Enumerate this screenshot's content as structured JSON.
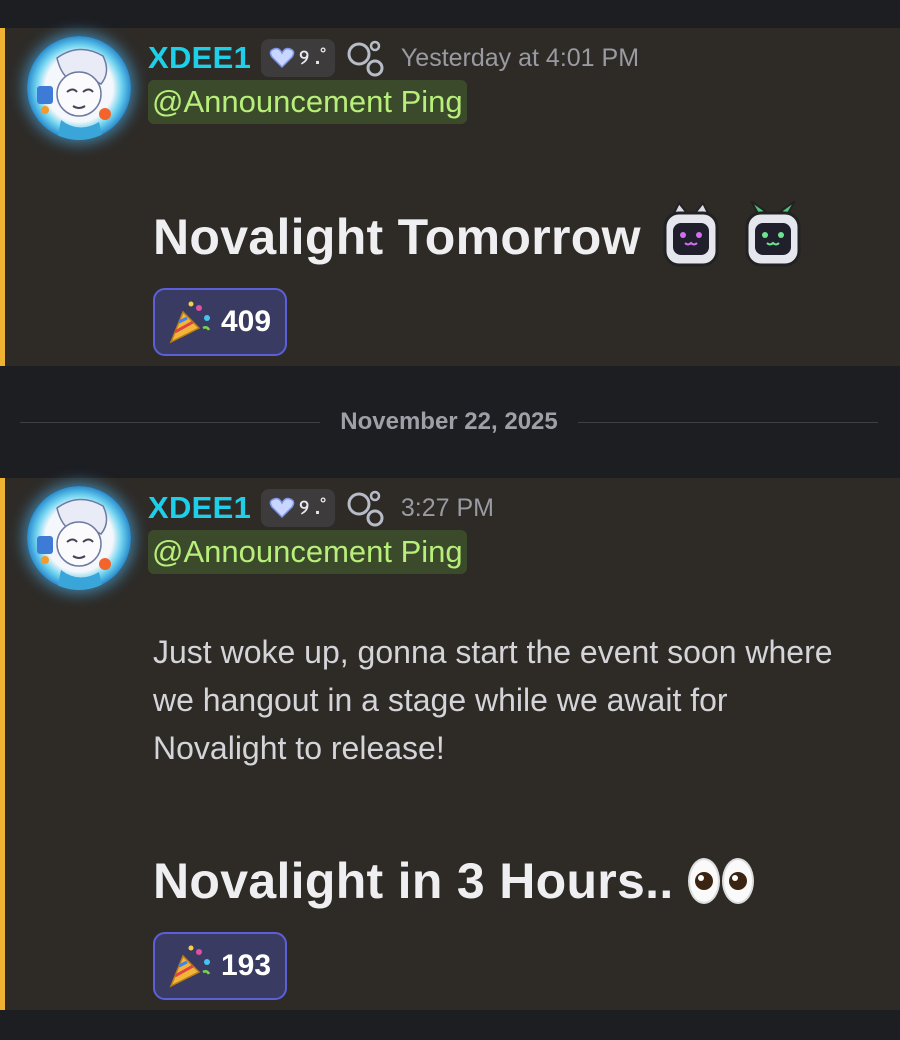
{
  "colors": {
    "username": "#1ecfea",
    "mention_text": "#b8ef7a",
    "mention_bg": "#3a4a2a",
    "highlight_border": "#f0b232",
    "reaction_border": "#5b60d8",
    "message_bg": "#2e2b27",
    "page_bg": "#1d1e22"
  },
  "messages": [
    {
      "username": "XDEE1",
      "tag": "୨ .˚",
      "timestamp": "Yesterday at 4:01 PM",
      "mention": "@Announcement Ping",
      "body": "",
      "headline": "Novalight Tomorrow",
      "headline_emojis": [
        "cat-robot-emoji",
        "bunny-robot-emoji"
      ],
      "reaction": {
        "emoji": "party-popper-icon",
        "count": "409"
      }
    },
    {
      "username": "XDEE1",
      "tag": "୨ .˚",
      "timestamp": "3:27 PM",
      "mention": "@Announcement Ping",
      "body": "Just woke up, gonna start the event soon where we hangout in a stage while we await for Novalight to release!",
      "headline": "Novalight in 3 Hours..",
      "headline_emojis": [
        "eyes-emoji"
      ],
      "reaction": {
        "emoji": "party-popper-icon",
        "count": "193"
      }
    }
  ],
  "date_divider": "November 22, 2025"
}
